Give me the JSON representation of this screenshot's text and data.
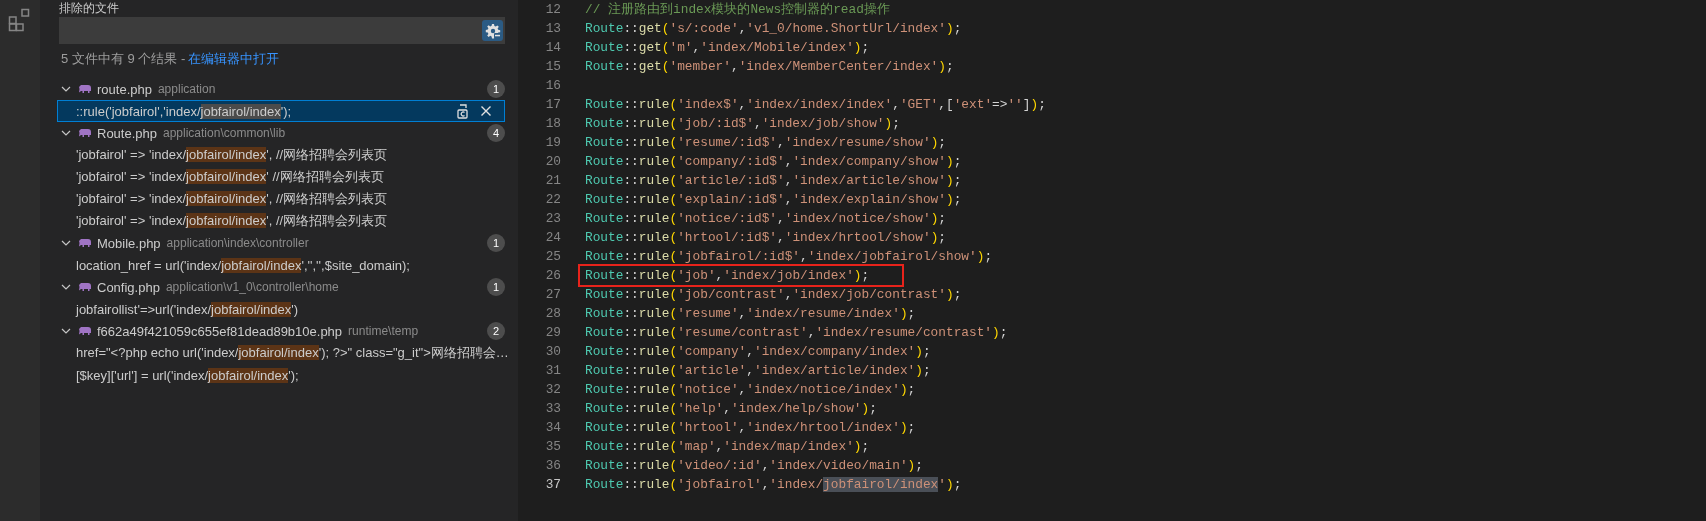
{
  "search_panel": {
    "exclude_label": "排除的文件",
    "use_exclude_settings": true,
    "summary": "5 文件中有 9 个结果 - ",
    "open_in_editor_link": "在编辑器中打开",
    "files": [
      {
        "name": "route.php",
        "path": "application",
        "count": "1",
        "expanded": true,
        "matches": [
          {
            "before": "::rule('jobfairol','index/",
            "match": "jobfairol/index",
            "after": "');",
            "selected": true
          }
        ]
      },
      {
        "name": "Route.php",
        "path": "application\\common\\lib",
        "count": "4",
        "expanded": true,
        "matches": [
          {
            "before": "'jobfairol' => 'index/",
            "match": "jobfairol/index",
            "after": "', //网络招聘会列表页",
            "selected": false
          },
          {
            "before": "'jobfairol' => 'index/",
            "match": "jobfairol/index",
            "after": "' //网络招聘会列表页",
            "selected": false
          },
          {
            "before": "'jobfairol' => 'index/",
            "match": "jobfairol/index",
            "after": "', //网络招聘会列表页",
            "selected": false
          },
          {
            "before": "'jobfairol' => 'index/",
            "match": "jobfairol/index",
            "after": "', //网络招聘会列表页",
            "selected": false
          }
        ]
      },
      {
        "name": "Mobile.php",
        "path": "application\\index\\controller",
        "count": "1",
        "expanded": true,
        "matches": [
          {
            "before": "location_href = url('index/",
            "match": "jobfairol/index",
            "after": "','','',$site_domain);",
            "selected": false
          }
        ]
      },
      {
        "name": "Config.php",
        "path": "application\\v1_0\\controller\\home",
        "count": "1",
        "expanded": true,
        "matches": [
          {
            "before": "jobfairollist'=>url('index/",
            "match": "jobfairol/index",
            "after": "')",
            "selected": false
          }
        ]
      },
      {
        "name": "f662a49f421059c655ef81dead89b10e.php",
        "path": "runtime\\temp",
        "count": "2",
        "expanded": true,
        "matches": [
          {
            "before": "href=\"<?php echo url('index/",
            "match": "jobfairol/index",
            "after": "'); ?>\" class=\"g_it\">网络招聘会…",
            "selected": false
          },
          {
            "before": "[$key]['url'] = url('index/",
            "match": "jobfairol/index",
            "after": "');",
            "selected": false
          }
        ]
      }
    ]
  },
  "editor": {
    "lines": [
      {
        "number": "12",
        "current": false,
        "boxed": false,
        "tokens": [
          {
            "kind": "comment",
            "text": "// 注册路由到index模块的News控制器的read操作"
          }
        ]
      },
      {
        "number": "13",
        "current": false,
        "boxed": false,
        "tokens": [
          {
            "kind": "class",
            "text": "Route"
          },
          {
            "kind": "punct",
            "text": "::"
          },
          {
            "kind": "method",
            "text": "get"
          },
          {
            "kind": "bracket",
            "text": "("
          },
          {
            "kind": "string",
            "text": "'s/:code'"
          },
          {
            "kind": "punct",
            "text": ","
          },
          {
            "kind": "string",
            "text": "'v1_0/home.ShortUrl/index'"
          },
          {
            "kind": "bracket",
            "text": ")"
          },
          {
            "kind": "punct",
            "text": ";"
          }
        ]
      },
      {
        "number": "14",
        "current": false,
        "boxed": false,
        "tokens": [
          {
            "kind": "class",
            "text": "Route"
          },
          {
            "kind": "punct",
            "text": "::"
          },
          {
            "kind": "method",
            "text": "get"
          },
          {
            "kind": "bracket",
            "text": "("
          },
          {
            "kind": "string",
            "text": "'m'"
          },
          {
            "kind": "punct",
            "text": ","
          },
          {
            "kind": "string",
            "text": "'index/Mobile/index'"
          },
          {
            "kind": "bracket",
            "text": ")"
          },
          {
            "kind": "punct",
            "text": ";"
          }
        ]
      },
      {
        "number": "15",
        "current": false,
        "boxed": false,
        "tokens": [
          {
            "kind": "class",
            "text": "Route"
          },
          {
            "kind": "punct",
            "text": "::"
          },
          {
            "kind": "method",
            "text": "get"
          },
          {
            "kind": "bracket",
            "text": "("
          },
          {
            "kind": "string",
            "text": "'member'"
          },
          {
            "kind": "punct",
            "text": ","
          },
          {
            "kind": "string",
            "text": "'index/MemberCenter/index'"
          },
          {
            "kind": "bracket",
            "text": ")"
          },
          {
            "kind": "punct",
            "text": ";"
          }
        ]
      },
      {
        "number": "16",
        "current": false,
        "boxed": false
      },
      {
        "number": "17",
        "current": false,
        "boxed": false,
        "tokens": [
          {
            "kind": "class",
            "text": "Route"
          },
          {
            "kind": "punct",
            "text": "::"
          },
          {
            "kind": "method",
            "text": "rule"
          },
          {
            "kind": "bracket",
            "text": "("
          },
          {
            "kind": "string",
            "text": "'index$'"
          },
          {
            "kind": "punct",
            "text": ","
          },
          {
            "kind": "string",
            "text": "'index/index/index'"
          },
          {
            "kind": "punct",
            "text": ","
          },
          {
            "kind": "string",
            "text": "'GET'"
          },
          {
            "kind": "punct",
            "text": ",["
          },
          {
            "kind": "string",
            "text": "'ext'"
          },
          {
            "kind": "punct",
            "text": "=>"
          },
          {
            "kind": "string",
            "text": "''"
          },
          {
            "kind": "punct",
            "text": "]"
          },
          {
            "kind": "bracket",
            "text": ")"
          },
          {
            "kind": "punct",
            "text": ";"
          }
        ]
      },
      {
        "number": "18",
        "current": false,
        "boxed": false,
        "tokens": [
          {
            "kind": "class",
            "text": "Route"
          },
          {
            "kind": "punct",
            "text": "::"
          },
          {
            "kind": "method",
            "text": "rule"
          },
          {
            "kind": "bracket",
            "text": "("
          },
          {
            "kind": "string",
            "text": "'job/:id$'"
          },
          {
            "kind": "punct",
            "text": ","
          },
          {
            "kind": "string",
            "text": "'index/job/show'"
          },
          {
            "kind": "bracket",
            "text": ")"
          },
          {
            "kind": "punct",
            "text": ";"
          }
        ]
      },
      {
        "number": "19",
        "current": false,
        "boxed": false,
        "tokens": [
          {
            "kind": "class",
            "text": "Route"
          },
          {
            "kind": "punct",
            "text": "::"
          },
          {
            "kind": "method",
            "text": "rule"
          },
          {
            "kind": "bracket",
            "text": "("
          },
          {
            "kind": "string",
            "text": "'resume/:id$'"
          },
          {
            "kind": "punct",
            "text": ","
          },
          {
            "kind": "string",
            "text": "'index/resume/show'"
          },
          {
            "kind": "bracket",
            "text": ")"
          },
          {
            "kind": "punct",
            "text": ";"
          }
        ]
      },
      {
        "number": "20",
        "current": false,
        "boxed": false,
        "tokens": [
          {
            "kind": "class",
            "text": "Route"
          },
          {
            "kind": "punct",
            "text": "::"
          },
          {
            "kind": "method",
            "text": "rule"
          },
          {
            "kind": "bracket",
            "text": "("
          },
          {
            "kind": "string",
            "text": "'company/:id$'"
          },
          {
            "kind": "punct",
            "text": ","
          },
          {
            "kind": "string",
            "text": "'index/company/show'"
          },
          {
            "kind": "bracket",
            "text": ")"
          },
          {
            "kind": "punct",
            "text": ";"
          }
        ]
      },
      {
        "number": "21",
        "current": false,
        "boxed": false,
        "tokens": [
          {
            "kind": "class",
            "text": "Route"
          },
          {
            "kind": "punct",
            "text": "::"
          },
          {
            "kind": "method",
            "text": "rule"
          },
          {
            "kind": "bracket",
            "text": "("
          },
          {
            "kind": "string",
            "text": "'article/:id$'"
          },
          {
            "kind": "punct",
            "text": ","
          },
          {
            "kind": "string",
            "text": "'index/article/show'"
          },
          {
            "kind": "bracket",
            "text": ")"
          },
          {
            "kind": "punct",
            "text": ";"
          }
        ]
      },
      {
        "number": "22",
        "current": false,
        "boxed": false,
        "tokens": [
          {
            "kind": "class",
            "text": "Route"
          },
          {
            "kind": "punct",
            "text": "::"
          },
          {
            "kind": "method",
            "text": "rule"
          },
          {
            "kind": "bracket",
            "text": "("
          },
          {
            "kind": "string",
            "text": "'explain/:id$'"
          },
          {
            "kind": "punct",
            "text": ","
          },
          {
            "kind": "string",
            "text": "'index/explain/show'"
          },
          {
            "kind": "bracket",
            "text": ")"
          },
          {
            "kind": "punct",
            "text": ";"
          }
        ]
      },
      {
        "number": "23",
        "current": false,
        "boxed": false,
        "tokens": [
          {
            "kind": "class",
            "text": "Route"
          },
          {
            "kind": "punct",
            "text": "::"
          },
          {
            "kind": "method",
            "text": "rule"
          },
          {
            "kind": "bracket",
            "text": "("
          },
          {
            "kind": "string",
            "text": "'notice/:id$'"
          },
          {
            "kind": "punct",
            "text": ","
          },
          {
            "kind": "string",
            "text": "'index/notice/show'"
          },
          {
            "kind": "bracket",
            "text": ")"
          },
          {
            "kind": "punct",
            "text": ";"
          }
        ]
      },
      {
        "number": "24",
        "current": false,
        "boxed": false,
        "tokens": [
          {
            "kind": "class",
            "text": "Route"
          },
          {
            "kind": "punct",
            "text": "::"
          },
          {
            "kind": "method",
            "text": "rule"
          },
          {
            "kind": "bracket",
            "text": "("
          },
          {
            "kind": "string",
            "text": "'hrtool/:id$'"
          },
          {
            "kind": "punct",
            "text": ","
          },
          {
            "kind": "string",
            "text": "'index/hrtool/show'"
          },
          {
            "kind": "bracket",
            "text": ")"
          },
          {
            "kind": "punct",
            "text": ";"
          }
        ]
      },
      {
        "number": "25",
        "current": false,
        "boxed": false,
        "tokens": [
          {
            "kind": "class",
            "text": "Route"
          },
          {
            "kind": "punct",
            "text": "::"
          },
          {
            "kind": "method",
            "text": "rule"
          },
          {
            "kind": "bracket",
            "text": "("
          },
          {
            "kind": "string",
            "text": "'jobfairol/:id$'"
          },
          {
            "kind": "punct",
            "text": ","
          },
          {
            "kind": "string",
            "text": "'index/jobfairol/show'"
          },
          {
            "kind": "bracket",
            "text": ")"
          },
          {
            "kind": "punct",
            "text": ";"
          }
        ]
      },
      {
        "number": "26",
        "current": false,
        "boxed": true,
        "tokens": [
          {
            "kind": "class",
            "text": "Route"
          },
          {
            "kind": "punct",
            "text": "::"
          },
          {
            "kind": "method",
            "text": "rule"
          },
          {
            "kind": "bracket",
            "text": "("
          },
          {
            "kind": "string",
            "text": "'job'"
          },
          {
            "kind": "punct",
            "text": ","
          },
          {
            "kind": "string",
            "text": "'index/job/index'"
          },
          {
            "kind": "bracket",
            "text": ")"
          },
          {
            "kind": "punct",
            "text": ";"
          }
        ]
      },
      {
        "number": "27",
        "current": false,
        "boxed": false,
        "tokens": [
          {
            "kind": "class",
            "text": "Route"
          },
          {
            "kind": "punct",
            "text": "::"
          },
          {
            "kind": "method",
            "text": "rule"
          },
          {
            "kind": "bracket",
            "text": "("
          },
          {
            "kind": "string",
            "text": "'job/contrast'"
          },
          {
            "kind": "punct",
            "text": ","
          },
          {
            "kind": "string",
            "text": "'index/job/contrast'"
          },
          {
            "kind": "bracket",
            "text": ")"
          },
          {
            "kind": "punct",
            "text": ";"
          }
        ]
      },
      {
        "number": "28",
        "current": false,
        "boxed": false,
        "tokens": [
          {
            "kind": "class",
            "text": "Route"
          },
          {
            "kind": "punct",
            "text": "::"
          },
          {
            "kind": "method",
            "text": "rule"
          },
          {
            "kind": "bracket",
            "text": "("
          },
          {
            "kind": "string",
            "text": "'resume'"
          },
          {
            "kind": "punct",
            "text": ","
          },
          {
            "kind": "string",
            "text": "'index/resume/index'"
          },
          {
            "kind": "bracket",
            "text": ")"
          },
          {
            "kind": "punct",
            "text": ";"
          }
        ]
      },
      {
        "number": "29",
        "current": false,
        "boxed": false,
        "tokens": [
          {
            "kind": "class",
            "text": "Route"
          },
          {
            "kind": "punct",
            "text": "::"
          },
          {
            "kind": "method",
            "text": "rule"
          },
          {
            "kind": "bracket",
            "text": "("
          },
          {
            "kind": "string",
            "text": "'resume/contrast'"
          },
          {
            "kind": "punct",
            "text": ","
          },
          {
            "kind": "string",
            "text": "'index/resume/contrast'"
          },
          {
            "kind": "bracket",
            "text": ")"
          },
          {
            "kind": "punct",
            "text": ";"
          }
        ]
      },
      {
        "number": "30",
        "current": false,
        "boxed": false,
        "tokens": [
          {
            "kind": "class",
            "text": "Route"
          },
          {
            "kind": "punct",
            "text": "::"
          },
          {
            "kind": "method",
            "text": "rule"
          },
          {
            "kind": "bracket",
            "text": "("
          },
          {
            "kind": "string",
            "text": "'company'"
          },
          {
            "kind": "punct",
            "text": ","
          },
          {
            "kind": "string",
            "text": "'index/company/index'"
          },
          {
            "kind": "bracket",
            "text": ")"
          },
          {
            "kind": "punct",
            "text": ";"
          }
        ]
      },
      {
        "number": "31",
        "current": false,
        "boxed": false,
        "tokens": [
          {
            "kind": "class",
            "text": "Route"
          },
          {
            "kind": "punct",
            "text": "::"
          },
          {
            "kind": "method",
            "text": "rule"
          },
          {
            "kind": "bracket",
            "text": "("
          },
          {
            "kind": "string",
            "text": "'article'"
          },
          {
            "kind": "punct",
            "text": ","
          },
          {
            "kind": "string",
            "text": "'index/article/index'"
          },
          {
            "kind": "bracket",
            "text": ")"
          },
          {
            "kind": "punct",
            "text": ";"
          }
        ]
      },
      {
        "number": "32",
        "current": false,
        "boxed": false,
        "tokens": [
          {
            "kind": "class",
            "text": "Route"
          },
          {
            "kind": "punct",
            "text": "::"
          },
          {
            "kind": "method",
            "text": "rule"
          },
          {
            "kind": "bracket",
            "text": "("
          },
          {
            "kind": "string",
            "text": "'notice'"
          },
          {
            "kind": "punct",
            "text": ","
          },
          {
            "kind": "string",
            "text": "'index/notice/index'"
          },
          {
            "kind": "bracket",
            "text": ")"
          },
          {
            "kind": "punct",
            "text": ";"
          }
        ]
      },
      {
        "number": "33",
        "current": false,
        "boxed": false,
        "tokens": [
          {
            "kind": "class",
            "text": "Route"
          },
          {
            "kind": "punct",
            "text": "::"
          },
          {
            "kind": "method",
            "text": "rule"
          },
          {
            "kind": "bracket",
            "text": "("
          },
          {
            "kind": "string",
            "text": "'help'"
          },
          {
            "kind": "punct",
            "text": ","
          },
          {
            "kind": "string",
            "text": "'index/help/show'"
          },
          {
            "kind": "bracket",
            "text": ")"
          },
          {
            "kind": "punct",
            "text": ";"
          }
        ]
      },
      {
        "number": "34",
        "current": false,
        "boxed": false,
        "tokens": [
          {
            "kind": "class",
            "text": "Route"
          },
          {
            "kind": "punct",
            "text": "::"
          },
          {
            "kind": "method",
            "text": "rule"
          },
          {
            "kind": "bracket",
            "text": "("
          },
          {
            "kind": "string",
            "text": "'hrtool'"
          },
          {
            "kind": "punct",
            "text": ","
          },
          {
            "kind": "string",
            "text": "'index/hrtool/index'"
          },
          {
            "kind": "bracket",
            "text": ")"
          },
          {
            "kind": "punct",
            "text": ";"
          }
        ]
      },
      {
        "number": "35",
        "current": false,
        "boxed": false,
        "tokens": [
          {
            "kind": "class",
            "text": "Route"
          },
          {
            "kind": "punct",
            "text": "::"
          },
          {
            "kind": "method",
            "text": "rule"
          },
          {
            "kind": "bracket",
            "text": "("
          },
          {
            "kind": "string",
            "text": "'map'"
          },
          {
            "kind": "punct",
            "text": ","
          },
          {
            "kind": "string",
            "text": "'index/map/index'"
          },
          {
            "kind": "bracket",
            "text": ")"
          },
          {
            "kind": "punct",
            "text": ";"
          }
        ]
      },
      {
        "number": "36",
        "current": false,
        "boxed": false,
        "tokens": [
          {
            "kind": "class",
            "text": "Route"
          },
          {
            "kind": "punct",
            "text": "::"
          },
          {
            "kind": "method",
            "text": "rule"
          },
          {
            "kind": "bracket",
            "text": "("
          },
          {
            "kind": "string",
            "text": "'video/:id'"
          },
          {
            "kind": "punct",
            "text": ","
          },
          {
            "kind": "string",
            "text": "'index/video/main'"
          },
          {
            "kind": "bracket",
            "text": ")"
          },
          {
            "kind": "punct",
            "text": ";"
          }
        ]
      },
      {
        "number": "37",
        "current": true,
        "boxed": false,
        "tokens": [
          {
            "kind": "class",
            "text": "Route"
          },
          {
            "kind": "punct",
            "text": "::"
          },
          {
            "kind": "method",
            "text": "rule"
          },
          {
            "kind": "bracket",
            "text": "("
          },
          {
            "kind": "string",
            "text": "'jobfairol'"
          },
          {
            "kind": "punct",
            "text": ","
          },
          {
            "kind": "string",
            "text": "'index/"
          },
          {
            "kind": "match",
            "text": "jobfairol/index"
          },
          {
            "kind": "string",
            "text": "'"
          },
          {
            "kind": "bracket",
            "text": ")"
          },
          {
            "kind": "punct",
            "text": ";"
          }
        ]
      }
    ]
  }
}
